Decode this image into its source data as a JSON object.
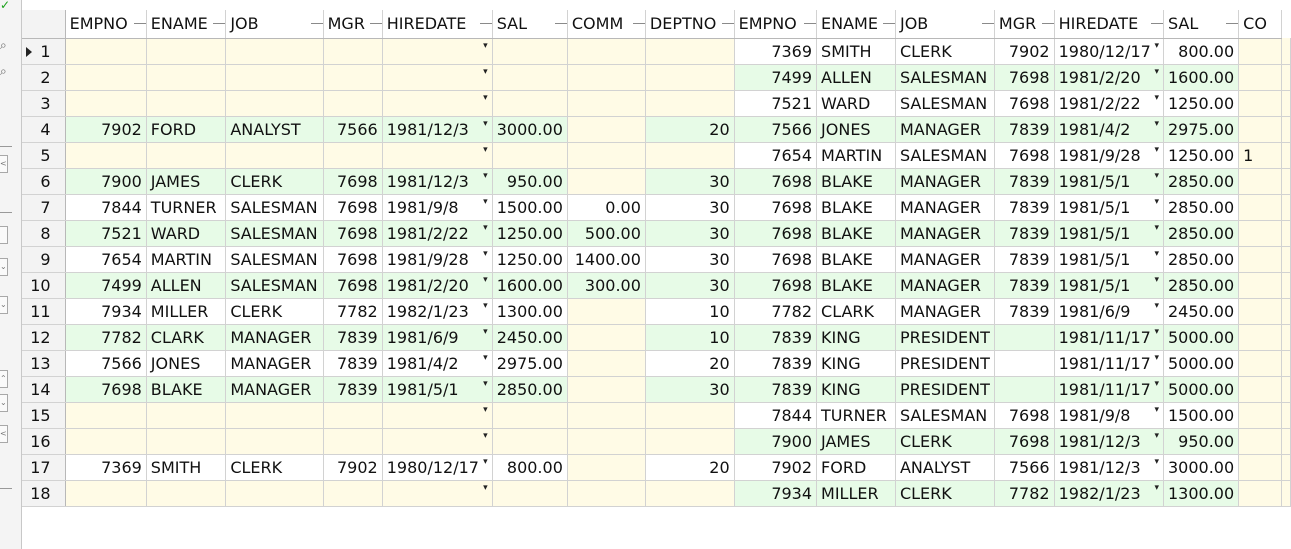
{
  "columns": [
    "EMPNO",
    "ENAME",
    "JOB",
    "MGR",
    "HIREDATE",
    "SAL",
    "COMM",
    "DEPTNO",
    "EMPNO",
    "ENAME",
    "JOB",
    "MGR",
    "HIREDATE",
    "SAL",
    "CO"
  ],
  "rows": [
    {
      "num": "1",
      "cells": [
        "",
        "",
        "",
        "",
        "",
        "",
        "",
        "",
        "7369",
        "SMITH",
        "CLERK",
        "7902",
        "1980/12/17",
        "800.00",
        ""
      ]
    },
    {
      "num": "2",
      "cells": [
        "",
        "",
        "",
        "",
        "",
        "",
        "",
        "",
        "7499",
        "ALLEN",
        "SALESMAN",
        "7698",
        "1981/2/20",
        "1600.00",
        ""
      ]
    },
    {
      "num": "3",
      "cells": [
        "",
        "",
        "",
        "",
        "",
        "",
        "",
        "",
        "7521",
        "WARD",
        "SALESMAN",
        "7698",
        "1981/2/22",
        "1250.00",
        ""
      ]
    },
    {
      "num": "4",
      "cells": [
        "7902",
        "FORD",
        "ANALYST",
        "7566",
        "1981/12/3",
        "3000.00",
        "",
        "20",
        "7566",
        "JONES",
        "MANAGER",
        "7839",
        "1981/4/2",
        "2975.00",
        ""
      ]
    },
    {
      "num": "5",
      "cells": [
        "",
        "",
        "",
        "",
        "",
        "",
        "",
        "",
        "7654",
        "MARTIN",
        "SALESMAN",
        "7698",
        "1981/9/28",
        "1250.00",
        "1"
      ]
    },
    {
      "num": "6",
      "cells": [
        "7900",
        "JAMES",
        "CLERK",
        "7698",
        "1981/12/3",
        "950.00",
        "",
        "30",
        "7698",
        "BLAKE",
        "MANAGER",
        "7839",
        "1981/5/1",
        "2850.00",
        ""
      ]
    },
    {
      "num": "7",
      "cells": [
        "7844",
        "TURNER",
        "SALESMAN",
        "7698",
        "1981/9/8",
        "1500.00",
        "0.00",
        "30",
        "7698",
        "BLAKE",
        "MANAGER",
        "7839",
        "1981/5/1",
        "2850.00",
        ""
      ]
    },
    {
      "num": "8",
      "cells": [
        "7521",
        "WARD",
        "SALESMAN",
        "7698",
        "1981/2/22",
        "1250.00",
        "500.00",
        "30",
        "7698",
        "BLAKE",
        "MANAGER",
        "7839",
        "1981/5/1",
        "2850.00",
        ""
      ]
    },
    {
      "num": "9",
      "cells": [
        "7654",
        "MARTIN",
        "SALESMAN",
        "7698",
        "1981/9/28",
        "1250.00",
        "1400.00",
        "30",
        "7698",
        "BLAKE",
        "MANAGER",
        "7839",
        "1981/5/1",
        "2850.00",
        ""
      ]
    },
    {
      "num": "10",
      "cells": [
        "7499",
        "ALLEN",
        "SALESMAN",
        "7698",
        "1981/2/20",
        "1600.00",
        "300.00",
        "30",
        "7698",
        "BLAKE",
        "MANAGER",
        "7839",
        "1981/5/1",
        "2850.00",
        ""
      ]
    },
    {
      "num": "11",
      "cells": [
        "7934",
        "MILLER",
        "CLERK",
        "7782",
        "1982/1/23",
        "1300.00",
        "",
        "10",
        "7782",
        "CLARK",
        "MANAGER",
        "7839",
        "1981/6/9",
        "2450.00",
        ""
      ]
    },
    {
      "num": "12",
      "cells": [
        "7782",
        "CLARK",
        "MANAGER",
        "7839",
        "1981/6/9",
        "2450.00",
        "",
        "10",
        "7839",
        "KING",
        "PRESIDENT",
        "",
        "1981/11/17",
        "5000.00",
        ""
      ]
    },
    {
      "num": "13",
      "cells": [
        "7566",
        "JONES",
        "MANAGER",
        "7839",
        "1981/4/2",
        "2975.00",
        "",
        "20",
        "7839",
        "KING",
        "PRESIDENT",
        "",
        "1981/11/17",
        "5000.00",
        ""
      ]
    },
    {
      "num": "14",
      "cells": [
        "7698",
        "BLAKE",
        "MANAGER",
        "7839",
        "1981/5/1",
        "2850.00",
        "",
        "30",
        "7839",
        "KING",
        "PRESIDENT",
        "",
        "1981/11/17",
        "5000.00",
        ""
      ]
    },
    {
      "num": "15",
      "cells": [
        "",
        "",
        "",
        "",
        "",
        "",
        "",
        "",
        "7844",
        "TURNER",
        "SALESMAN",
        "7698",
        "1981/9/8",
        "1500.00",
        ""
      ]
    },
    {
      "num": "16",
      "cells": [
        "",
        "",
        "",
        "",
        "",
        "",
        "",
        "",
        "7900",
        "JAMES",
        "CLERK",
        "7698",
        "1981/12/3",
        "950.00",
        ""
      ]
    },
    {
      "num": "17",
      "cells": [
        "7369",
        "SMITH",
        "CLERK",
        "7902",
        "1980/12/17",
        "800.00",
        "",
        "20",
        "7902",
        "FORD",
        "ANALYST",
        "7566",
        "1981/12/3",
        "3000.00",
        ""
      ]
    },
    {
      "num": "18",
      "cells": [
        "",
        "",
        "",
        "",
        "",
        "",
        "",
        "",
        "7934",
        "MILLER",
        "CLERK",
        "7782",
        "1982/1/23",
        "1300.00",
        ""
      ]
    }
  ],
  "colors": {
    "row_even": "#e7fbe7",
    "row_odd": "#ffffff",
    "blank_cell": "#fffbe6",
    "grid_line": "#d2d2d2",
    "check_icon": "#1aa11a"
  },
  "icons": {
    "current_row": "triangle-right-icon",
    "date_picker": "dropdown-arrow-icon",
    "commit": "check-icon",
    "search": "magnifier-icon"
  }
}
